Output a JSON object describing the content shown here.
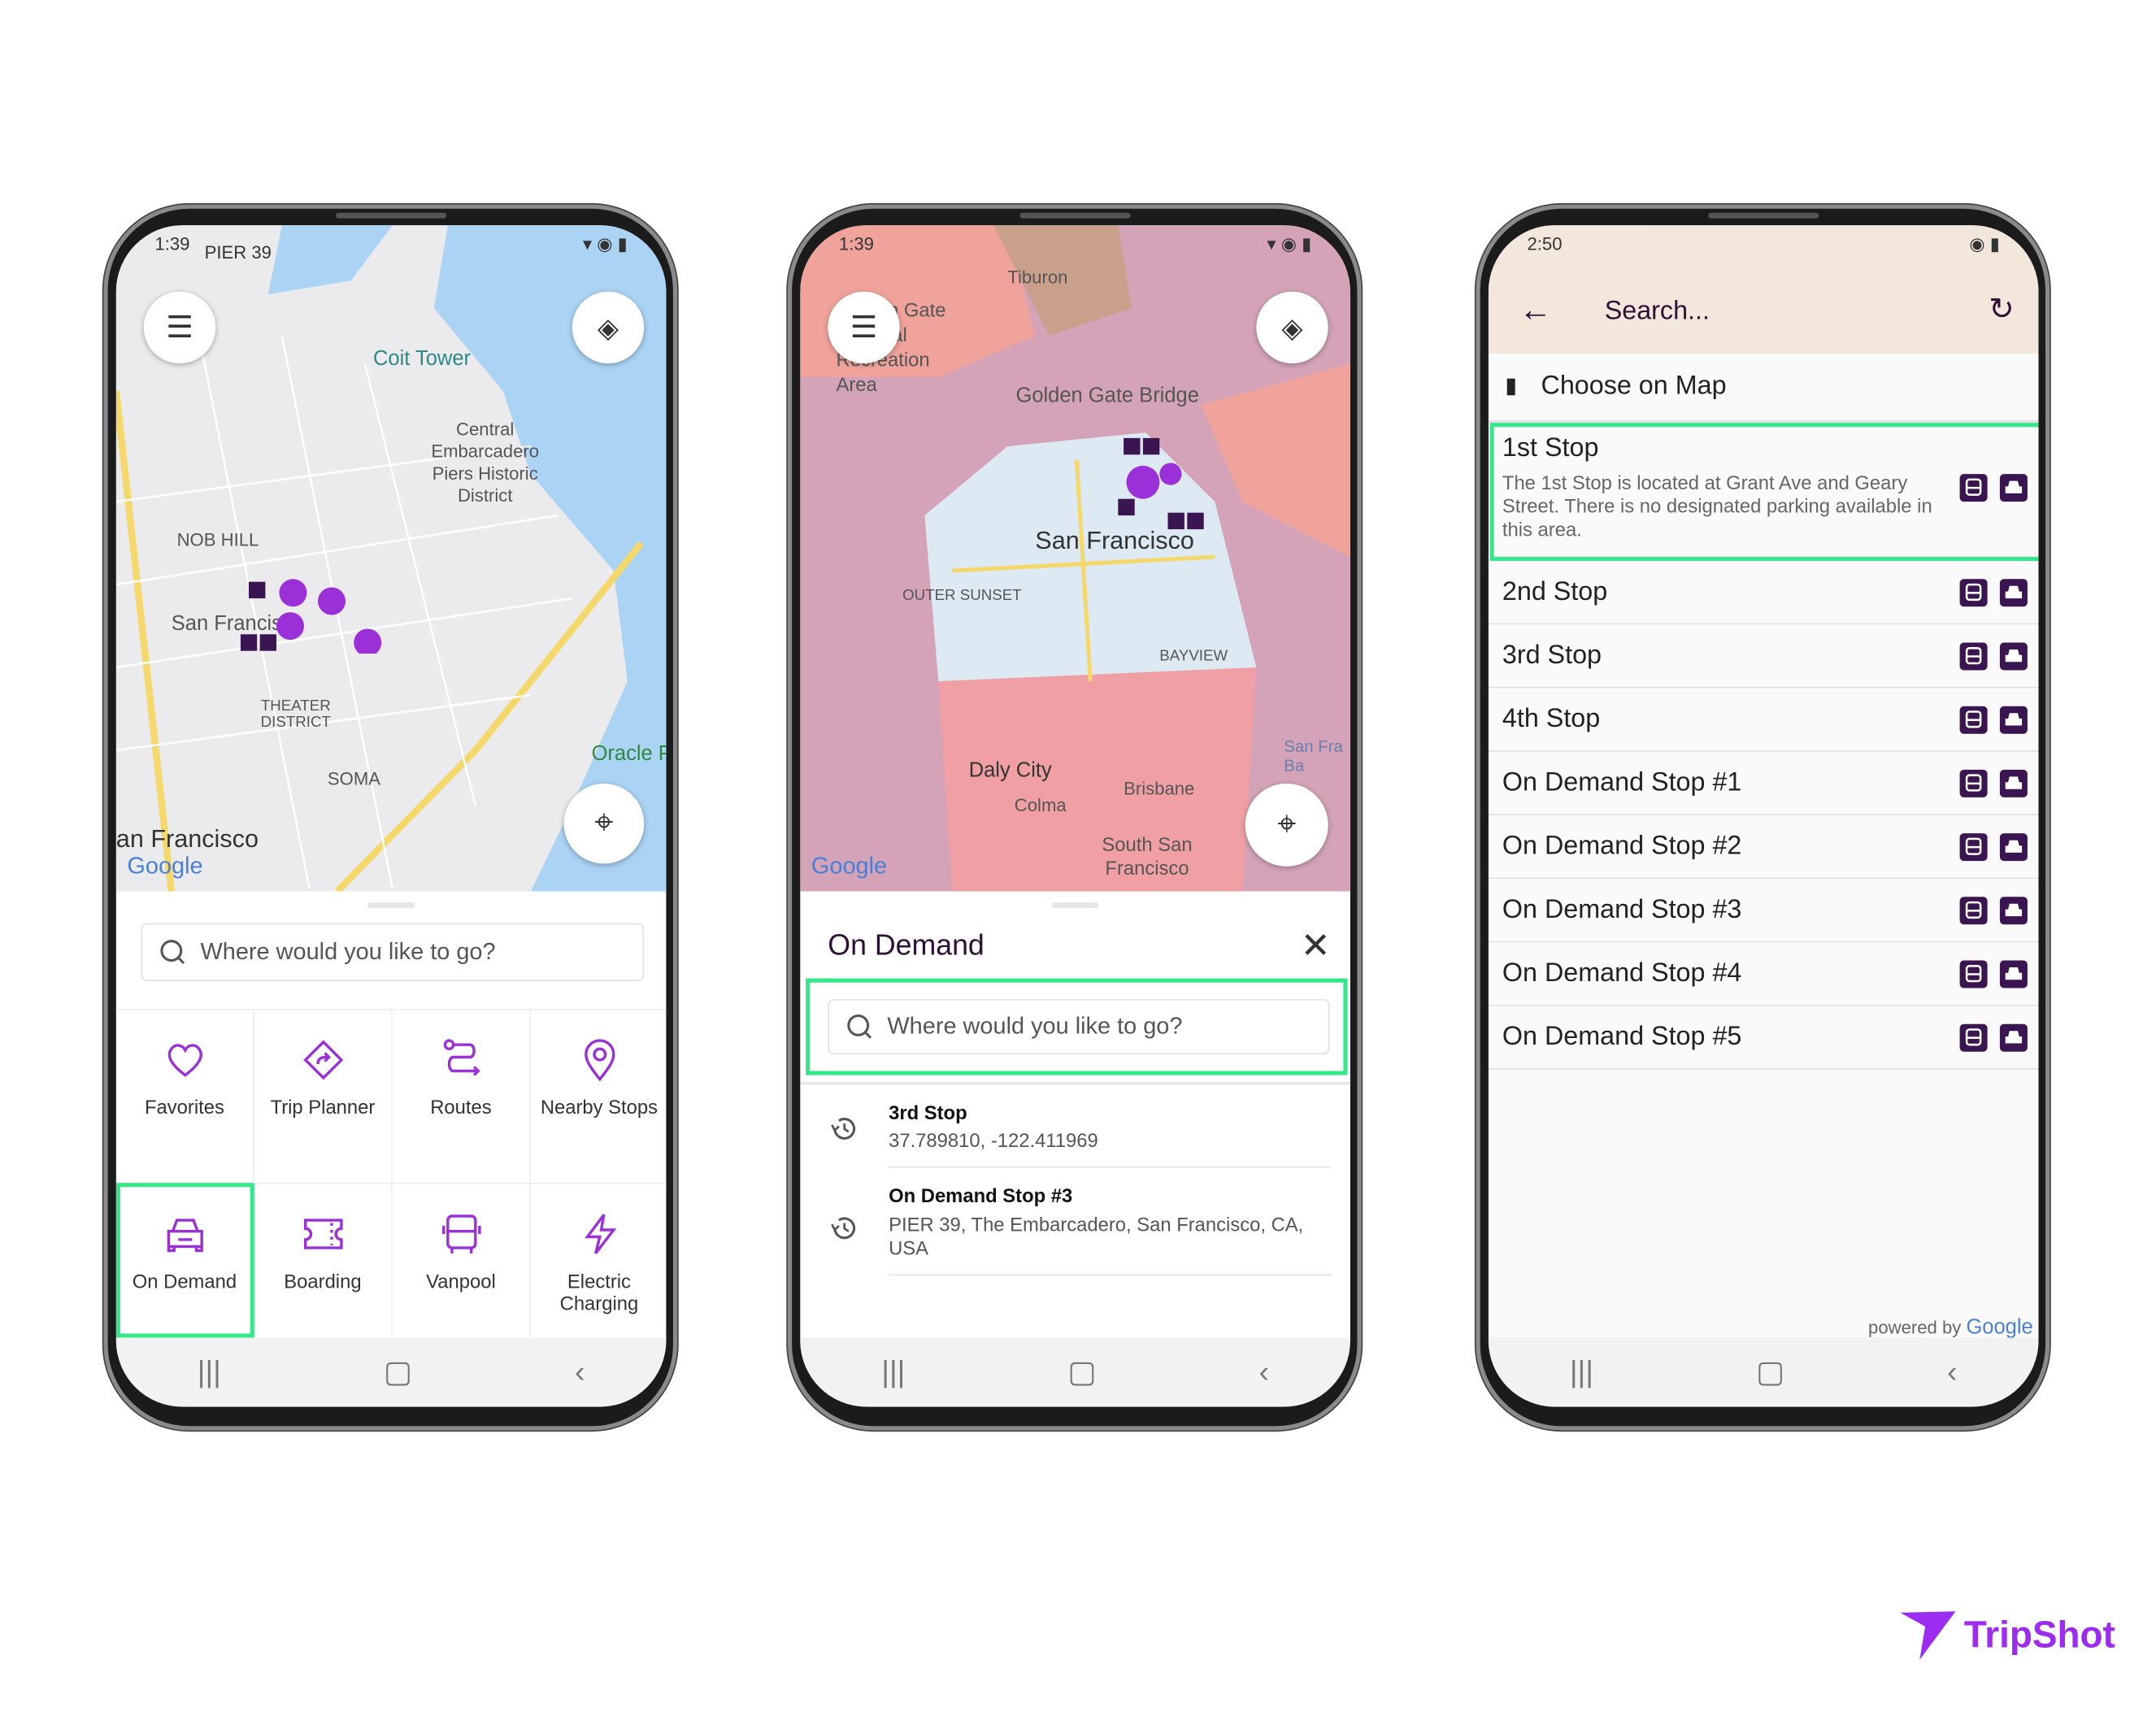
{
  "brand": {
    "name": "TripShot",
    "color": "#9b2cf0"
  },
  "colors": {
    "accent": "#9b30d9",
    "highlight": "#34e88a",
    "dark_purple": "#3b1452",
    "header_bg": "#f3e7dc"
  },
  "phone1": {
    "status_time": "1:39",
    "map_labels": [
      "PIER 39",
      "Coit Tower",
      "Central Embarcadero Piers Historic District",
      "NOB HILL",
      "San Francisco",
      "THEATER DISTRICT",
      "SOMA",
      "Oracle P",
      "an Francisco",
      "Google"
    ],
    "search_placeholder": "Where would you like to go?",
    "tiles": [
      {
        "label": "Favorites",
        "icon": "heart-icon"
      },
      {
        "label": "Trip Planner",
        "icon": "directions-icon"
      },
      {
        "label": "Routes",
        "icon": "route-icon"
      },
      {
        "label": "Nearby Stops",
        "icon": "location-pin-icon"
      },
      {
        "label": "On Demand",
        "icon": "car-icon",
        "highlighted": true
      },
      {
        "label": "Boarding",
        "icon": "ticket-icon"
      },
      {
        "label": "Vanpool",
        "icon": "van-icon"
      },
      {
        "label": "Electric Charging",
        "icon": "lightning-icon"
      }
    ]
  },
  "phone2": {
    "status_time": "1:39",
    "map_labels": [
      "Tiburon",
      "Golden Gate National Recreation Area",
      "Golden Gate Bridge",
      "San Francisco",
      "OUTER SUNSET",
      "BAYVIEW",
      "Daly City",
      "Colma",
      "Brisbane",
      "South San Francisco",
      "San Fra Ba",
      "Google"
    ],
    "panel_title": "On Demand",
    "search_placeholder": "Where would you like to go?",
    "history": [
      {
        "title": "3rd Stop",
        "subtitle": "37.789810, -122.411969"
      },
      {
        "title": "On Demand Stop #3",
        "subtitle": "PIER 39, The Embarcadero, San Francisco, CA, USA"
      }
    ]
  },
  "phone3": {
    "status_time": "2:50",
    "search_placeholder": "Search...",
    "choose_on_map": "Choose on Map",
    "first_stop": {
      "name": "1st Stop",
      "description": "The 1st Stop is located at Grant Ave and Geary Street. There is no designated parking available in this area."
    },
    "stops": [
      "2nd Stop",
      "3rd Stop",
      "4th Stop",
      "On Demand Stop #1",
      "On Demand Stop #2",
      "On Demand Stop #3",
      "On Demand Stop #4",
      "On Demand Stop #5"
    ],
    "powered_by": "powered by",
    "powered_brand": "Google"
  }
}
